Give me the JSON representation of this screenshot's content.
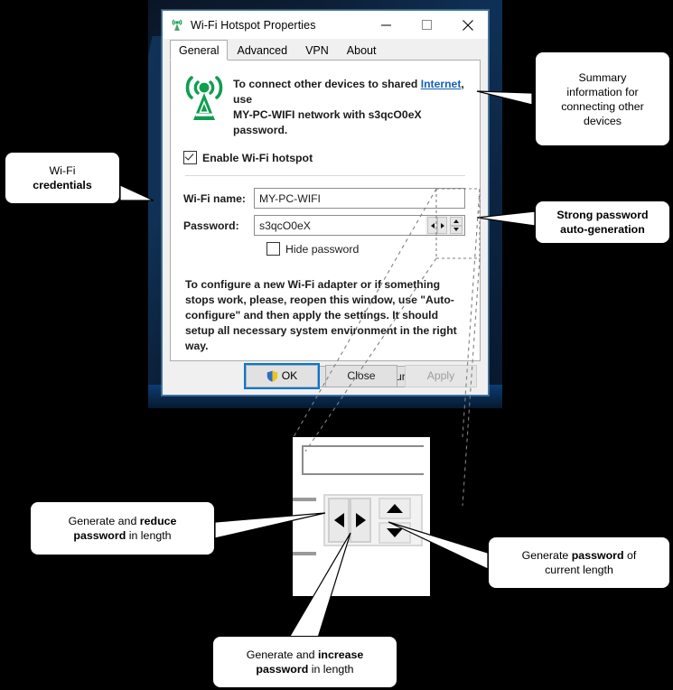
{
  "window": {
    "title": "Wi-Fi Hotspot Properties",
    "icon": "wifi-tower-icon",
    "controls": {
      "minimize": "─",
      "maximize": "□",
      "close": "✕"
    }
  },
  "tabs": [
    {
      "label": "General",
      "active": true
    },
    {
      "label": "Advanced",
      "active": false
    },
    {
      "label": "VPN",
      "active": false
    },
    {
      "label": "About",
      "active": false
    }
  ],
  "banner": {
    "line1_a": "To connect other devices to shared ",
    "link": "Internet",
    "line1_b": ", use",
    "line2_a": "MY-PC-WIFI",
    "line2_b": " network with ",
    "line2_c": "s3qcO0eX",
    "line2_d": " password."
  },
  "enable": {
    "label": "Enable Wi-Fi hotspot",
    "checked": true
  },
  "form": {
    "name_label": "Wi-Fi name:",
    "name_value": "MY-PC-WIFI",
    "password_label": "Password:",
    "password_value": "s3qcO0eX",
    "hide_password_label": "Hide password",
    "hide_password_checked": false
  },
  "info_text": "To configure a new Wi-Fi adapter or if something stops work, please, reopen this window, use \"Auto-configure\" and then apply the settings. It should setup all necessary system environment in the right way.",
  "buttons": {
    "auto_configure": "Auto-configure",
    "ok": "OK",
    "close": "Close",
    "apply": "Apply",
    "apply_disabled": true
  },
  "callouts": {
    "summary": {
      "line1": "Summary",
      "line2": "information for",
      "line3": "connecting other",
      "line4": "devices"
    },
    "credentials": {
      "line1": "Wi-Fi",
      "line2_bold": "credentials"
    },
    "strong_password": {
      "line1_bold": "Strong password",
      "line2_bold": "auto-generation"
    },
    "reduce": {
      "a": "Generate and ",
      "b_bold": "reduce",
      "c_bold": "password",
      "d": " in length"
    },
    "increase": {
      "a": "Generate and ",
      "b_bold": "increase",
      "c_bold": "password",
      "d": " in length"
    },
    "current": {
      "a": "Generate ",
      "b_bold": "password",
      "c": " of",
      "d": "current length"
    }
  },
  "colors": {
    "accent": "#0078d7",
    "link": "#1461b7",
    "tower_green": "#0f9d4f",
    "desktop": "#0d2744",
    "dialog_bg": "#f0f0f0"
  }
}
